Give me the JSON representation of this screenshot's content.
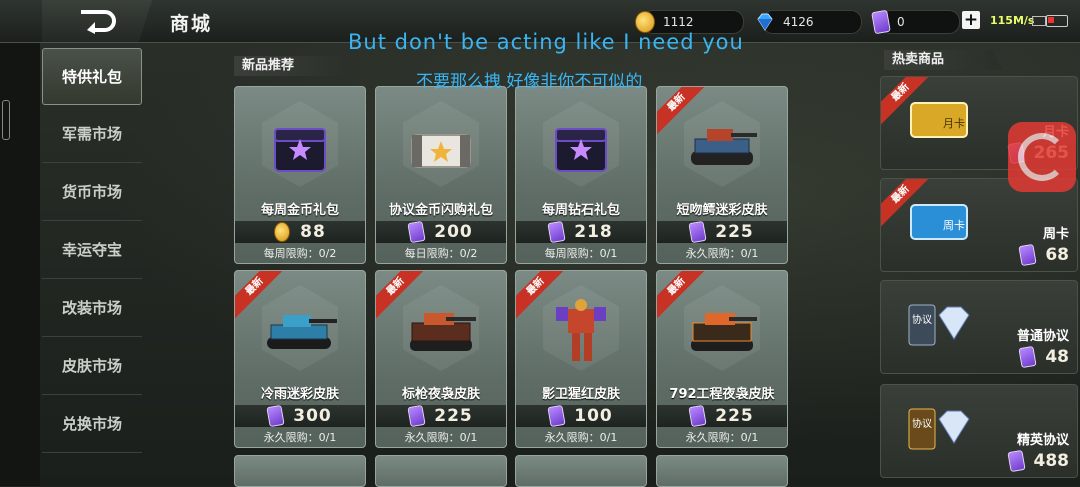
{
  "header": {
    "title": "商城",
    "gold": "1112",
    "diamond": "4126",
    "tickets": "0",
    "network_speed": "115M/s"
  },
  "subtitles": {
    "en": "But don't be acting like I need you",
    "zh": "不要那么拽 好像非你不可似的"
  },
  "sidebar": {
    "items": [
      {
        "label": "特供礼包",
        "active": true
      },
      {
        "label": "军需市场"
      },
      {
        "label": "货币市场"
      },
      {
        "label": "幸运夺宝"
      },
      {
        "label": "改装市场"
      },
      {
        "label": "皮肤市场"
      },
      {
        "label": "兑换市场"
      }
    ]
  },
  "sections": {
    "new": "新品推荐",
    "hot": "热卖商品"
  },
  "products": [
    {
      "name": "每周金币礼包",
      "price": "88",
      "currency": "coin",
      "limit": "每周限购：0/2",
      "tag": "",
      "icon": "purple-chest-icon"
    },
    {
      "name": "协议金币闪购礼包",
      "price": "200",
      "currency": "ticket",
      "limit": "每日限购：0/2",
      "tag": "",
      "icon": "white-chest-icon"
    },
    {
      "name": "每周钻石礼包",
      "price": "218",
      "currency": "ticket",
      "limit": "每周限购：0/1",
      "tag": "",
      "icon": "purple-chest-icon"
    },
    {
      "name": "短吻鳄迷彩皮肤",
      "price": "225",
      "currency": "ticket",
      "limit": "永久限购：0/1",
      "tag": "最新",
      "icon": "tank-skin-icon"
    },
    {
      "name": "冷雨迷彩皮肤",
      "price": "300",
      "currency": "ticket",
      "limit": "永久限购：0/1",
      "tag": "最新",
      "icon": "tank-skin-icon"
    },
    {
      "name": "标枪夜袅皮肤",
      "price": "225",
      "currency": "ticket",
      "limit": "永久限购：0/1",
      "tag": "最新",
      "icon": "tank-skin-icon"
    },
    {
      "name": "影卫猩红皮肤",
      "price": "100",
      "currency": "ticket",
      "limit": "永久限购：0/1",
      "tag": "最新",
      "icon": "mech-skin-icon"
    },
    {
      "name": "792工程夜袅皮肤",
      "price": "225",
      "currency": "ticket",
      "limit": "永久限购：0/1",
      "tag": "最新",
      "icon": "tank-skin-icon"
    }
  ],
  "hot_items": [
    {
      "name": "月卡",
      "price": "265",
      "tag": "最新",
      "icon": "month-card-icon"
    },
    {
      "name": "周卡",
      "price": "68",
      "tag": "最新",
      "icon": "week-card-icon"
    },
    {
      "name": "普通协议",
      "price": "48",
      "tag": "",
      "icon": "diamond-protocol-icon"
    },
    {
      "name": "精英协议",
      "price": "488",
      "tag": "",
      "icon": "diamond-protocol-icon"
    }
  ],
  "hot_card_labels": {
    "month": "月卡",
    "week": "周卡",
    "protocol": "协议"
  }
}
